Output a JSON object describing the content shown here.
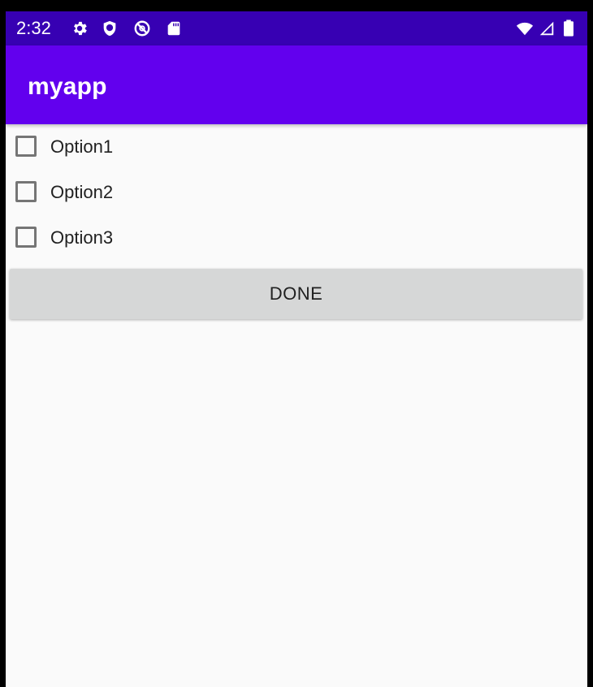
{
  "status_bar": {
    "time": "2:32",
    "color": "#3700b3",
    "icons_left": [
      "gear-icon",
      "shield-icon",
      "no-entry-at-icon",
      "sd-card-icon"
    ],
    "icons_right": [
      "wifi-icon",
      "cell-signal-icon",
      "battery-icon"
    ]
  },
  "app_bar": {
    "title": "myapp",
    "color": "#6200ee"
  },
  "options": [
    {
      "label": "Option1",
      "checked": false
    },
    {
      "label": "Option2",
      "checked": false
    },
    {
      "label": "Option3",
      "checked": false
    }
  ],
  "done_button": {
    "label": "DONE"
  }
}
